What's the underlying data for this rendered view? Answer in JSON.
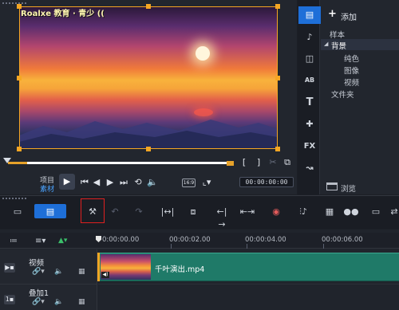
{
  "preview": {
    "overlay_text": "Roalxe 教育 · 青少 ((",
    "project_label": "项目",
    "clip_label": "素材",
    "timecode": "00:00:00:00",
    "aspect_label": "16:9"
  },
  "library": {
    "add_label": "添加",
    "tree": {
      "samples": "样本",
      "backgrounds": "背景",
      "solid_color": "纯色",
      "image": "图像",
      "video": "视频",
      "folder": "文件夹"
    },
    "browse_label": "浏览"
  },
  "timeline": {
    "ruler": [
      "0:00:00.00",
      "00:00:02.00",
      "00:00:04.00",
      "00:00:06.00"
    ],
    "video_track_label": "视频",
    "overlay_track_label": "叠加1",
    "clip_name": "千叶演出.mp4"
  },
  "colors": {
    "accent_blue": "#1e6fd8",
    "selection_orange": "#f5a623",
    "clip_green": "#1f7a68",
    "highlight_red": "#e02020"
  }
}
